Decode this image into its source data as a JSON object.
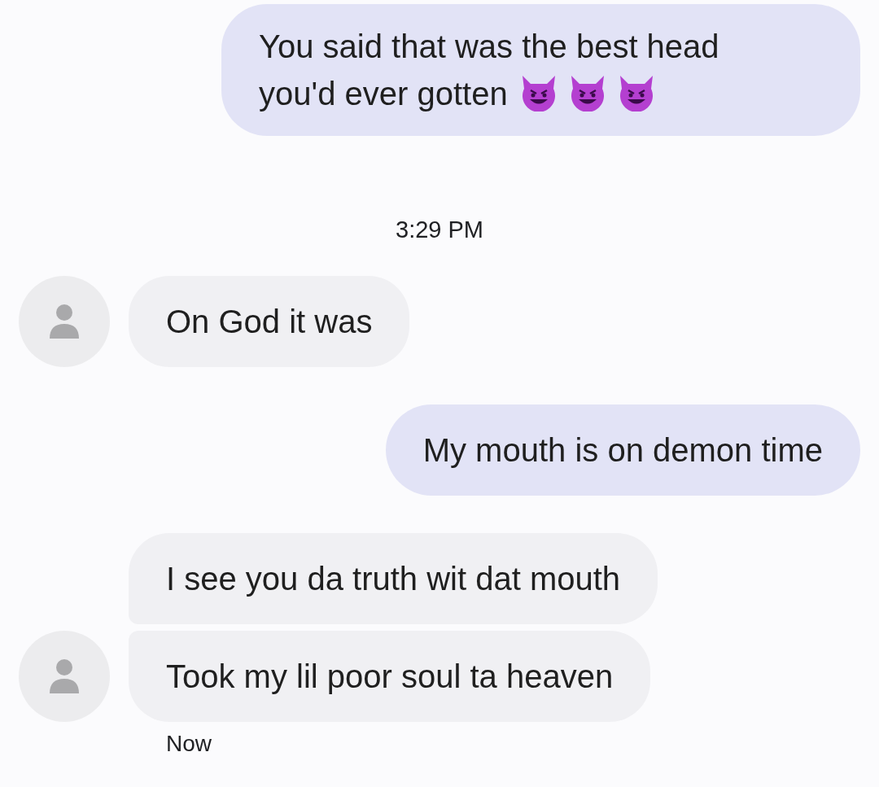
{
  "thread": [
    {
      "kind": "sent",
      "text": "You said that was the best head you'd ever gotten",
      "emoji": true
    },
    {
      "kind": "timestamp",
      "text": "3:29 PM"
    },
    {
      "kind": "received",
      "text": "On God it was",
      "emoji": false,
      "avatar": true
    },
    {
      "kind": "sent",
      "text": "My mouth is on demon time",
      "emoji": false
    },
    {
      "kind": "received",
      "text": "I see you da truth wit dat mouth",
      "emoji": false,
      "avatar": false
    },
    {
      "kind": "received",
      "text": "Took my lil poor soul ta heaven",
      "emoji": false,
      "avatar": true
    },
    {
      "kind": "status",
      "text": "Now"
    }
  ]
}
